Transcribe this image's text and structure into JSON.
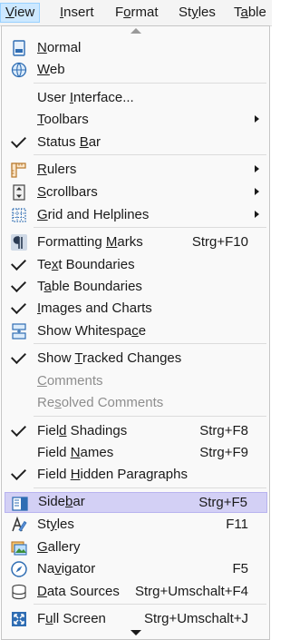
{
  "menubar": {
    "items": [
      {
        "label": "View",
        "u": "V"
      },
      {
        "label": "Insert",
        "u": "I"
      },
      {
        "label": "Format",
        "u": "o"
      },
      {
        "label": "Styles",
        "u": "y"
      },
      {
        "label": "Table",
        "u": "a"
      }
    ]
  },
  "menu": {
    "items": [
      {
        "label": "Normal",
        "u": "N",
        "icon": "normal-view-icon",
        "checked": false,
        "disabled": false,
        "accel": "",
        "submenu": false
      },
      {
        "label": "Web",
        "u": "W",
        "icon": "web-view-icon",
        "checked": false,
        "disabled": false,
        "accel": "",
        "submenu": false
      },
      {
        "label": "User Interface...",
        "u": "I",
        "icon": "",
        "checked": false,
        "disabled": false,
        "accel": "",
        "submenu": false
      },
      {
        "label": "Toolbars",
        "u": "T",
        "icon": "",
        "checked": false,
        "disabled": false,
        "accel": "",
        "submenu": true
      },
      {
        "label": "Status Bar",
        "u": "B",
        "icon": "",
        "checked": true,
        "disabled": false,
        "accel": "",
        "submenu": false
      },
      {
        "label": "Rulers",
        "u": "R",
        "icon": "rulers-icon",
        "checked": false,
        "disabled": false,
        "accel": "",
        "submenu": true
      },
      {
        "label": "Scrollbars",
        "u": "S",
        "icon": "scrollbars-icon",
        "checked": false,
        "disabled": false,
        "accel": "",
        "submenu": true
      },
      {
        "label": "Grid and Helplines",
        "u": "G",
        "icon": "grid-icon",
        "checked": false,
        "disabled": false,
        "accel": "",
        "submenu": true
      },
      {
        "label": "Formatting Marks",
        "u": "M",
        "icon": "formatting-marks-icon",
        "checked": false,
        "disabled": false,
        "accel": "Strg+F10",
        "submenu": false
      },
      {
        "label": "Text Boundaries",
        "u": "x",
        "icon": "",
        "checked": true,
        "disabled": false,
        "accel": "",
        "submenu": false
      },
      {
        "label": "Table Boundaries",
        "u": "a",
        "icon": "",
        "checked": true,
        "disabled": false,
        "accel": "",
        "submenu": false
      },
      {
        "label": "Images and Charts",
        "u": "I",
        "icon": "",
        "checked": true,
        "disabled": false,
        "accel": "",
        "submenu": false
      },
      {
        "label": "Show Whitespace",
        "u": "c",
        "icon": "whitespace-icon",
        "checked": false,
        "disabled": false,
        "accel": "",
        "submenu": false
      },
      {
        "label": "Show Tracked Changes",
        "u": "T",
        "icon": "",
        "checked": true,
        "disabled": false,
        "accel": "",
        "submenu": false
      },
      {
        "label": "Comments",
        "u": "C",
        "icon": "",
        "checked": false,
        "disabled": true,
        "accel": "",
        "submenu": false
      },
      {
        "label": "Resolved Comments",
        "u": "s",
        "icon": "",
        "checked": false,
        "disabled": true,
        "accel": "",
        "submenu": false
      },
      {
        "label": "Field Shadings",
        "u": "d",
        "icon": "",
        "checked": true,
        "disabled": false,
        "accel": "Strg+F8",
        "submenu": false
      },
      {
        "label": "Field Names",
        "u": "N",
        "icon": "",
        "checked": false,
        "disabled": false,
        "accel": "Strg+F9",
        "submenu": false
      },
      {
        "label": "Field Hidden Paragraphs",
        "u": "H",
        "icon": "",
        "checked": true,
        "disabled": false,
        "accel": "",
        "submenu": false
      },
      {
        "label": "Sidebar",
        "u": "b",
        "icon": "sidebar-icon",
        "checked": false,
        "disabled": false,
        "accel": "Strg+F5",
        "submenu": false,
        "highlighted": true
      },
      {
        "label": "Styles",
        "u": "y",
        "icon": "styles-icon",
        "checked": false,
        "disabled": false,
        "accel": "F11",
        "submenu": false
      },
      {
        "label": "Gallery",
        "u": "G",
        "icon": "gallery-icon",
        "checked": false,
        "disabled": false,
        "accel": "",
        "submenu": false
      },
      {
        "label": "Navigator",
        "u": "v",
        "icon": "navigator-icon",
        "checked": false,
        "disabled": false,
        "accel": "F5",
        "submenu": false
      },
      {
        "label": "Data Sources",
        "u": "D",
        "icon": "data-sources-icon",
        "checked": false,
        "disabled": false,
        "accel": "Strg+Umschalt+F4",
        "submenu": false
      },
      {
        "label": "Full Screen",
        "u": "u",
        "icon": "full-screen-icon",
        "checked": false,
        "disabled": false,
        "accel": "Strg+Umschalt+J",
        "submenu": false
      }
    ]
  }
}
